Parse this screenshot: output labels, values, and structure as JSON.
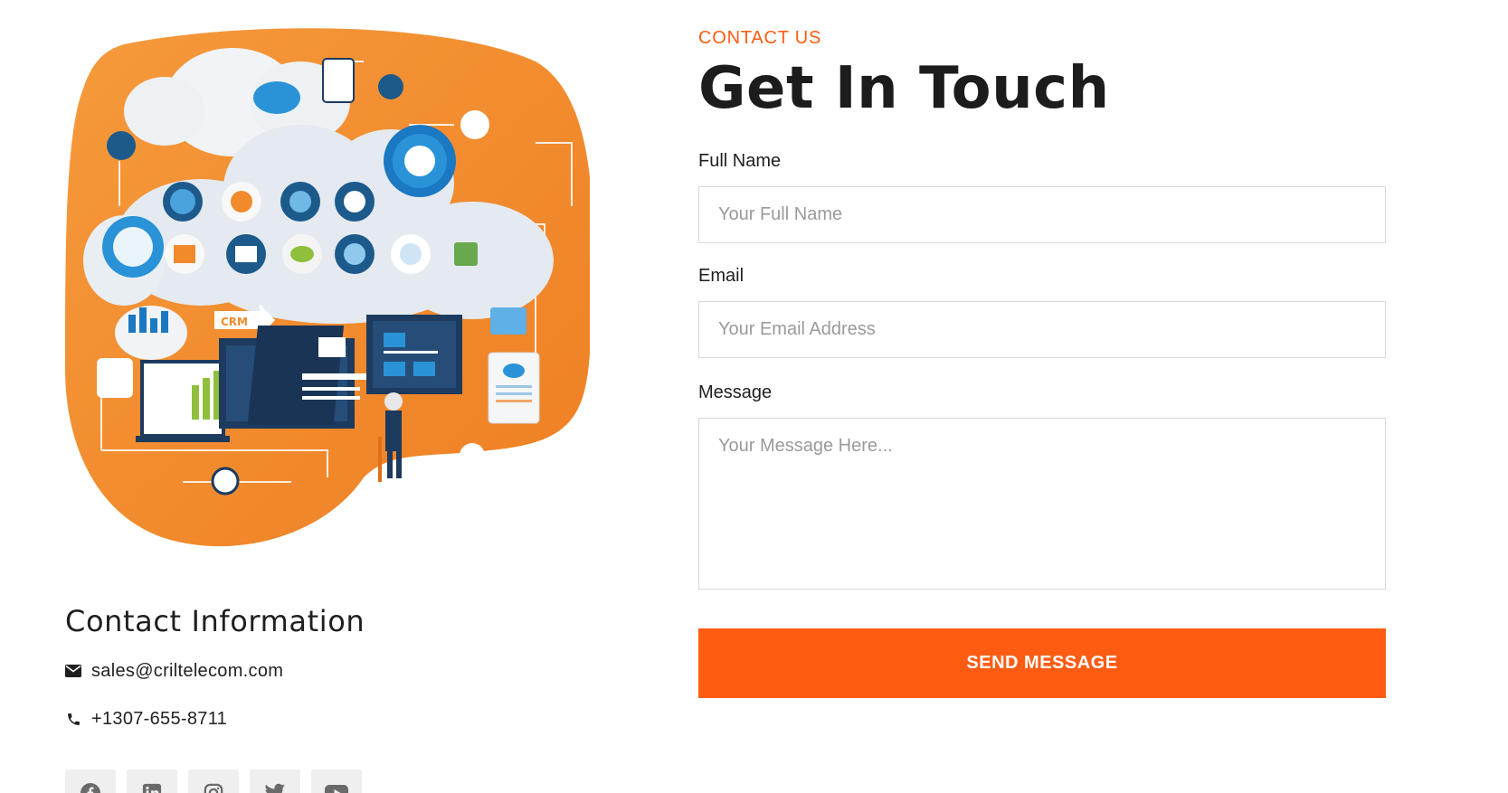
{
  "contact": {
    "eyebrow": "CONTACT US",
    "headline": "Get In Touch",
    "fields": {
      "full_name_label": "Full Name",
      "full_name_placeholder": "Your Full Name",
      "email_label": "Email",
      "email_placeholder": "Your Email Address",
      "message_label": "Message",
      "message_placeholder": "Your Message Here..."
    },
    "send_label": "SEND MESSAGE"
  },
  "illustration": {
    "crm_label": "CRM"
  },
  "info": {
    "title": "Contact Information",
    "email": "sales@criltelecom.com",
    "phone": "+1307-655-8711"
  },
  "socials": [
    {
      "icon": "facebook-icon"
    },
    {
      "icon": "linkedin-icon"
    },
    {
      "icon": "instagram-icon"
    },
    {
      "icon": "twitter-icon"
    },
    {
      "icon": "youtube-icon"
    }
  ],
  "colors": {
    "accent": "#ff5c13",
    "blob": "#f08a2c",
    "navy": "#1d3a5f",
    "cloud": "#e3e9ef"
  }
}
